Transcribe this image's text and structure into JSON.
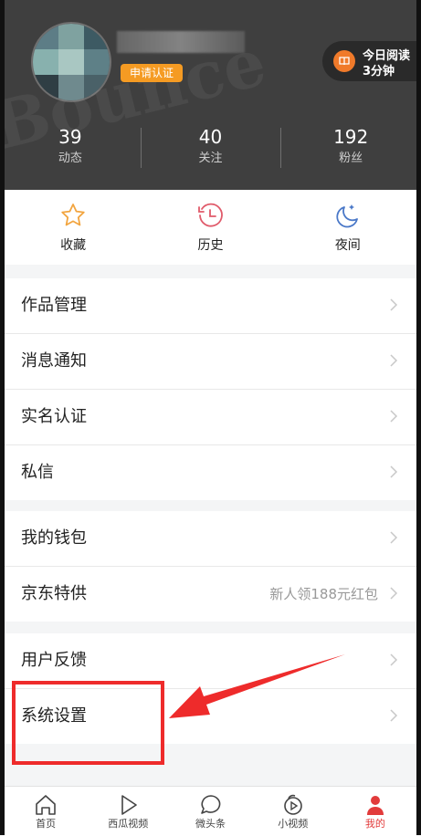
{
  "header": {
    "badge": "申请认证",
    "reading_line1": "今日阅读",
    "reading_line2": "3分钟",
    "stats": [
      {
        "value": "39",
        "label": "动态"
      },
      {
        "value": "40",
        "label": "关注"
      },
      {
        "value": "192",
        "label": "粉丝"
      }
    ]
  },
  "quick": [
    {
      "label": "收藏",
      "icon": "star-icon"
    },
    {
      "label": "历史",
      "icon": "clock-icon"
    },
    {
      "label": "夜间",
      "icon": "moon-icon"
    }
  ],
  "groups": [
    {
      "items": [
        {
          "label": "作品管理"
        },
        {
          "label": "消息通知"
        },
        {
          "label": "实名认证"
        },
        {
          "label": "私信"
        }
      ]
    },
    {
      "items": [
        {
          "label": "我的钱包"
        },
        {
          "label": "京东特供",
          "extra": "新人领188元红包"
        }
      ]
    },
    {
      "items": [
        {
          "label": "用户反馈"
        },
        {
          "label": "系统设置"
        }
      ]
    }
  ],
  "tabbar": [
    {
      "label": "首页",
      "icon": "home-icon"
    },
    {
      "label": "西瓜视频",
      "icon": "play-icon"
    },
    {
      "label": "微头条",
      "icon": "chat-bubble-icon"
    },
    {
      "label": "小视频",
      "icon": "video-icon"
    },
    {
      "label": "我的",
      "icon": "person-icon",
      "active": true
    }
  ],
  "colors": {
    "accent": "#e23b3b",
    "badge": "#f59b23",
    "reading": "#f07a2a",
    "annotation": "#ee2b2b"
  }
}
